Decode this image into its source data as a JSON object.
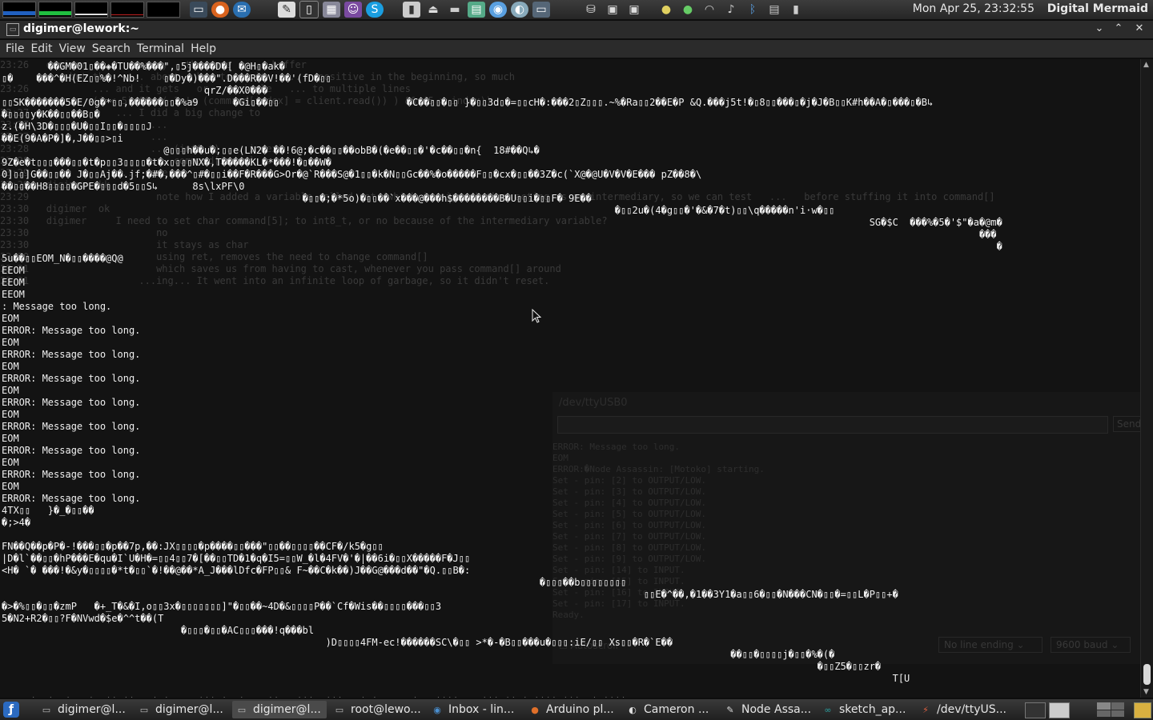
{
  "topbar": {
    "clock": "Mon Apr 25, 23:32:55",
    "user": "Digital Mermaid",
    "monitor_colors": [
      "#2060c0",
      "#20c040",
      "#e0e0e0",
      "#c02020",
      "#404040"
    ],
    "app_icons": [
      "terminal-icon",
      "firefox-icon",
      "thunderbird-icon",
      "skype-icon",
      "text-editor-icon",
      "terminal-icon",
      "calculator-icon",
      "pidgin-icon",
      "skype-icon"
    ],
    "tray_icons": [
      "network-icon",
      "volume-icon",
      "bluetooth-icon",
      "battery-icon"
    ]
  },
  "window": {
    "title": "digimer@lework:~",
    "menu": [
      "File",
      "Edit",
      "View",
      "Search",
      "Terminal",
      "Help"
    ]
  },
  "terminal": {
    "ghost_lines": [
      "",
      "23:26   digimer  ...   anyway   the same   ... buffer",
      "        ... but the   ... about   how to do it   ...   positive in the beginning, so much",
      "23:26           ... and it gets   or   a single   ... to multiple lines",
      "                (i < 5) && ((-1 != (command[index] = client.read()) ) && (5 > index))",
      "",
      "23:27               ... I did a big change to",
      "23:27                     ...",
      "23:27                     ...",
      "23:28                     ... (int8_t) ... index)",
      "23:28                     ... command[index] ...",
      "23:29                ... done",
      "23:29   digimer  kk",
      "23:29                      note how I added a variable called ret (which is signed) thus acting as an intermediary, so we can test   ...   before stuffing it into command[]",
      "23:30   digimer  ok",
      "23:30   digimer     I need to set char command[5]; to int8_t, or no because of the intermediary variable?",
      "23:30                      no",
      "23:30                      it stays as char",
      "23:30                      using ret, removes the need to change command[]",
      "",
      "23:31                      which saves us from having to cast, whenever you pass command[] around",
      "23:31                   ...ing... It went into an infinite loop of garbage, so it didn't reset."
    ],
    "lines": [
      "        ��GM�01▯��◈�TU��%���\",▯5j����D�[ �@H▯�ak�",
      "▯�    ���^�H(EZ▯▯%�!^Nb!    ▯�Dy�)���\".D���R��V!��'(fD�▯▯",
      "                                   qrZ/��X0���",
      "▯▯SK�������5�E/0g�*▯▯,������▯▯�%a9      �Gi▯��▯▯                      �C��▯▯�▯▯ }�▯▯3d▯�=▯▯cH�:���2▯Z▯▯▯.~%�Ra▯▯2��E�P &Q.���j5t!�▯8▯▯���▯�j�J�B▯▯K#h��A�▯���▯�B↳",
      "�▯▯▯▯y�K��▯▯��B▯�",
      "z.(�H\\3D�▯▯▯�U�▯▯I▯▯�▯▯▯▯J",
      "��E(9�A�P�]�,J��▯▯>▯i",
      "                            @▯▯▯h��u�;▯▯e(LN2� ��!6@;�c��▯▯��obB�(�e��▯▯�'�c��▯▯�n{  18#��Q↳�",
      "9Z�e�t▯▯▯���▯▯�t�p▯▯3▯▯▯▯�t�x▯▯▯▯NX�,T�����KL�*���!�▯��W�",
      "0]▯▯]G��▯▯�� J�▯▯Aj��.jf;�#�,���^▯#�▯▯i��F�R���G>Or�@`R���S@�1▯▯�k�N▯▯Gc��%�o�����F▯▯�cx�▯▯��3Z�c(`X@�@U�V�V�E��� pZ��8�\\",
      "��▯▯��H8▯▯▯▯�GPE�▯▯▯d�5▯▯S↳      8s\\lxPF\\0",
      "                                                    �▯▯�;�*5o)�▯▯��`x���@���h$��������B�U▯▯i�▯▯F� 9E��",
      "                                                                                                          �▯▯2u�(4�g▯▯�'�&�7�t)▯▯\\q�����n'i·w�▯▯",
      "                                                                                                                                                      SG�$C  ���%�5�'$\"�a�@m�",
      "                                                                                                                                                                         ���",
      "                                                                                                                                                                            �",
      "5u��▯▯EOM_N�▯▯����@Q@",
      "EEOM",
      "EEOM",
      "EEOM",
      ": Message too long.",
      "EOM",
      "ERROR: Message too long.",
      "EOM",
      "ERROR: Message too long.",
      "EOM",
      "ERROR: Message too long.",
      "EOM",
      "ERROR: Message too long.",
      "EOM",
      "ERROR: Message too long.",
      "EOM",
      "ERROR: Message too long.",
      "EOM",
      "ERROR: Message too long.",
      "EOM",
      "ERROR: Message too long.",
      "4TX▯▯   }�_�▯▯��",
      "�;>4�",
      "",
      "FN��Q��p�P�-!���▯▯�p��7p,��:JX▯▯▯▯�p����▯▯���\"▯▯��▯▯▯▯��CF�/k5�g▯▯",
      "|D�l`��▯▯�hP���E�qu�I`U�H�=▯▯4▯▯7�[��▯▯TD�1�q�I5=▯▯W_�l�4FV�'�|��6i�▯▯X�����F�J▯▯",
      "<H� `� ���!�&y�▯▯▯▯�*t�▯▯`�!��@��*A_J���lDfc�FP▯▯& F~��C�k��)J��G@���d��\"�Q.▯▯B�:",
      "                                                                                             �▯▯▯��b▯▯▯▯▯▯▯▯",
      "                                                                                                               ▯▯E�^��,�1��3Y1�a▯▯6�▯▯�N���CN�▯▯�=▯▯L�P▯▯+�",
      "�>�%▯▯�▯▯�zmP   �+_T�&�I,o▯▯3x�▯▯▯▯▯▯▯]\"�▯▯��~4D�&▯▯▯▯P��`Cf�Wis��▯▯▯▯���▯▯3",
      "5�N2+R2�▯▯?F�NVwd�$e�^^t��(T",
      "                               �▯▯▯�▯▯�AC▯▯▯���!q���bl",
      "                                                        )D▯▯▯▯4FM-ec!������SC\\�▯▯ >*�-�B▯▯���u�▯▯▯:iE/▯▯ Xs▯▯�R�`E��",
      "                                                                                                                              ��▯▯�▯▯▯▯j�▯▯�%�(�",
      "                                                                                                                                             �▯▯Z5�▯▯zr�",
      "                                                                                                                                                          T[U",
      "",
      "~K▯▯4�Ms�F8�G;:�1P��!��a>!�I�`▯▯▯i���*�s3�g&▯▯��▯▯'���▯▯���,5\\�f�ys▯▯ps�aCZ����▯▯▯▯���l��i�$����!���@C�i����#▯▯▯▯",
      "                                                                                                                                  �)"
    ]
  },
  "serial_monitor": {
    "title": "/dev/ttyUSB0",
    "send_label": "Send",
    "autoscroll_label": "Autoscroll",
    "line_ending": "No line ending",
    "baud": "9600 baud",
    "log": [
      "ERROR: Message too long.",
      "EOM",
      "ERROR:�Node Assassin: [Motoko] starting.",
      "Set - pin: [2] to OUTPUT/LOW.",
      "Set - pin: [3] to OUTPUT/LOW.",
      "Set - pin: [4] to OUTPUT/LOW.",
      "Set - pin: [5] to OUTPUT/LOW.",
      "Set - pin: [6] to OUTPUT/LOW.",
      "Set - pin: [7] to OUTPUT/LOW.",
      "Set - pin: [8] to OUTPUT/LOW.",
      "Set - pin: [9] to OUTPUT/LOW.",
      "Set - pin: [14] to INPUT.",
      "Set - pin: [15] to INPUT.",
      "Set - pin: [16] to INPUT.",
      "Set - pin: [17] to INPUT.",
      "Ready."
    ]
  },
  "taskbar": {
    "tasks": [
      {
        "label": "digimer@l...",
        "icon": "terminal-icon",
        "active": false
      },
      {
        "label": "digimer@l...",
        "icon": "terminal-icon",
        "active": false
      },
      {
        "label": "digimer@l...",
        "icon": "terminal-icon",
        "active": true
      },
      {
        "label": "root@lewo...",
        "icon": "terminal-icon",
        "active": false
      },
      {
        "label": "Inbox - lin...",
        "icon": "thunderbird-icon",
        "active": false
      },
      {
        "label": "Arduino pl...",
        "icon": "firefox-icon",
        "active": false
      },
      {
        "label": "Cameron ...",
        "icon": "chat-icon",
        "active": false
      },
      {
        "label": "Node Assa...",
        "icon": "text-editor-icon",
        "active": false
      },
      {
        "label": "sketch_ap...",
        "icon": "arduino-icon",
        "active": false
      },
      {
        "label": "/dev/ttyUS...",
        "icon": "serial-monitor-icon",
        "active": false
      }
    ]
  }
}
